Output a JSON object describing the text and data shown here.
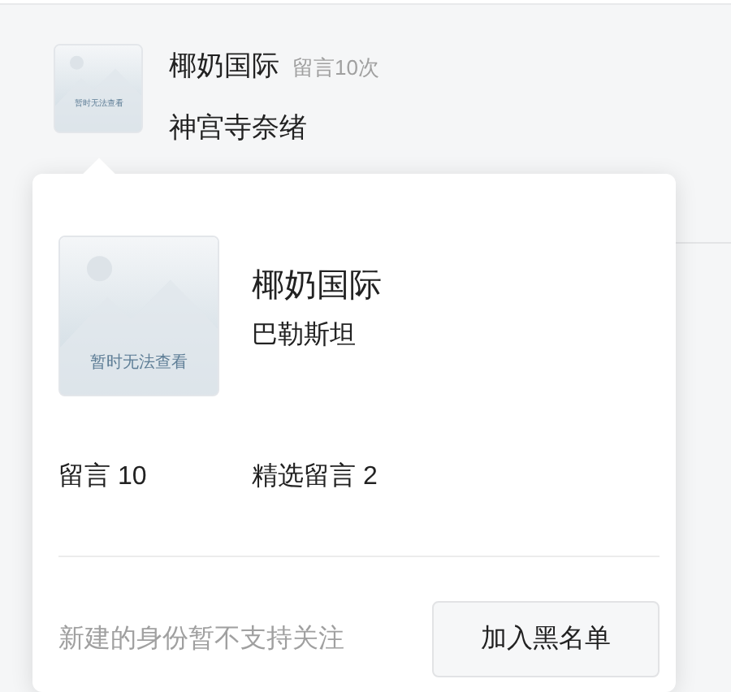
{
  "list_item": {
    "name": "椰奶国际",
    "meta": "留言10次",
    "message": "神宫寺奈绪",
    "avatar_caption": "暂时无法查看"
  },
  "popover": {
    "avatar_caption": "暂时无法查看",
    "name": "椰奶国际",
    "location": "巴勒斯坦",
    "stats": [
      {
        "label": "留言 10"
      },
      {
        "label": "精选留言 2"
      }
    ],
    "hint": "新建的身份暂不支持关注",
    "button": "加入黑名单"
  }
}
